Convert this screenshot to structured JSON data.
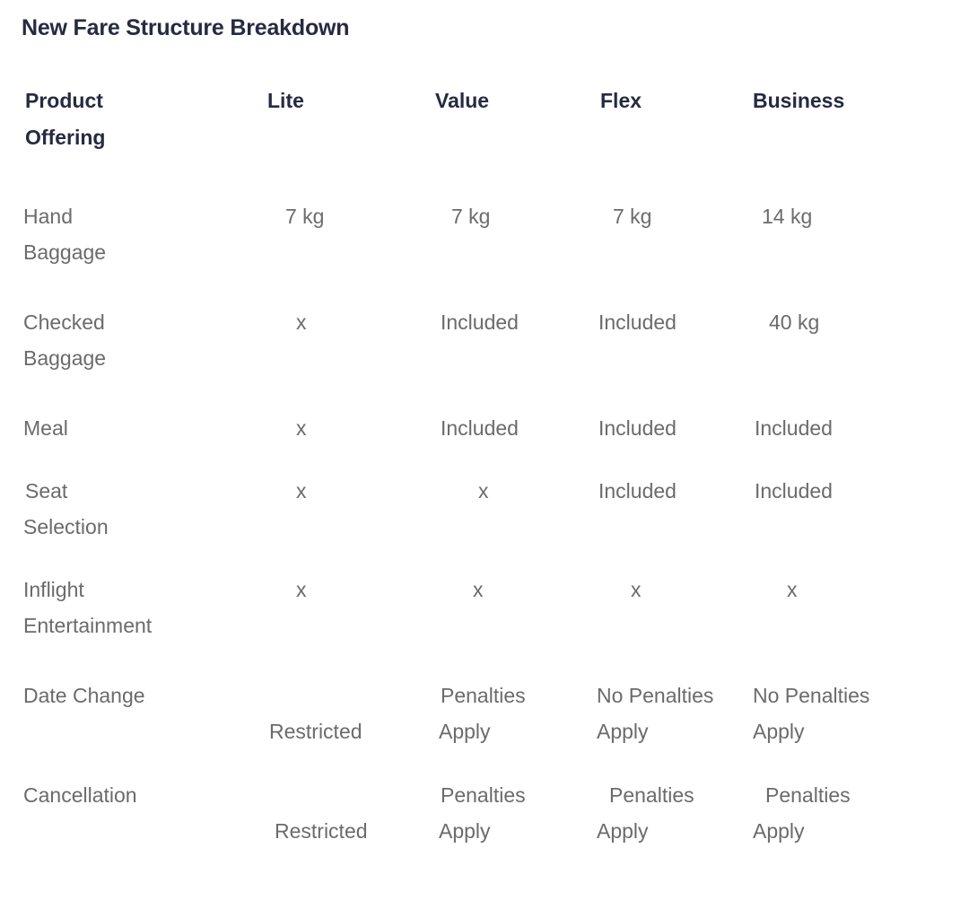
{
  "title": "New Fare Structure Breakdown",
  "colors": {
    "title": "#262a42",
    "header": "#262a42",
    "body_text": "#6b6b6b",
    "background": "#ffffff"
  },
  "table": {
    "columns": [
      {
        "key": "feature",
        "label_line1": "Product",
        "label_line2": "Offering"
      },
      {
        "key": "lite",
        "label_line1": "Lite",
        "label_line2": ""
      },
      {
        "key": "value",
        "label_line1": "Value",
        "label_line2": ""
      },
      {
        "key": "flex",
        "label_line1": "Flex",
        "label_line2": ""
      },
      {
        "key": "business",
        "label_line1": "Business",
        "label_line2": ""
      }
    ],
    "rows": [
      {
        "feature_line1": "Hand",
        "feature_line2": "Baggage",
        "lite": "7 kg",
        "value": "7 kg",
        "flex": "7 kg",
        "business": "14 kg"
      },
      {
        "feature_line1": "Checked",
        "feature_line2": "Baggage",
        "lite": "x",
        "value": "Included",
        "flex": "Included",
        "business": "40 kg"
      },
      {
        "feature_line1": "Meal",
        "feature_line2": "",
        "lite": "x",
        "value": "Included",
        "flex": "Included",
        "business": "Included"
      },
      {
        "feature_line1": "Seat",
        "feature_line2": "Selection",
        "lite": "x",
        "value": "x",
        "flex": "Included",
        "business": "Included"
      },
      {
        "feature_line1": "Inflight",
        "feature_line2": "Entertainment",
        "lite": "x",
        "value": "x",
        "flex": "x",
        "business": "x"
      },
      {
        "feature_line1": "Date Change",
        "feature_line2": "",
        "lite": "Restricted",
        "value_line1": "Penalties",
        "value_line2": "Apply",
        "flex_line1": "No Penalties",
        "flex_line2": "Apply",
        "business_line1": "No Penalties",
        "business_line2": "Apply"
      },
      {
        "feature_line1": "Cancellation",
        "feature_line2": "",
        "lite": "Restricted",
        "value_line1": "Penalties",
        "value_line2": "Apply",
        "flex_line1": "Penalties",
        "flex_line2": "Apply",
        "business_line1": "Penalties",
        "business_line2": "Apply"
      }
    ]
  }
}
